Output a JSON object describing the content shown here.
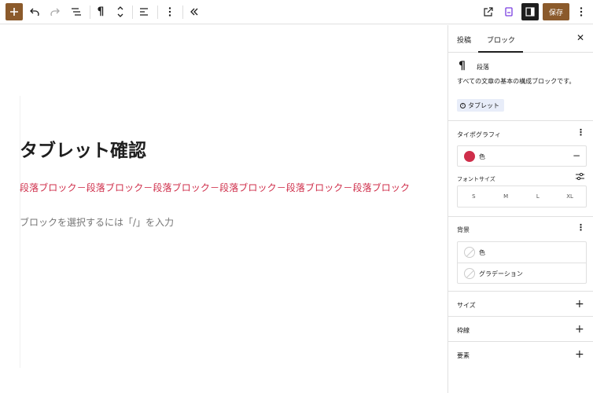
{
  "toolbar": {
    "inserter_icon": "plus-icon",
    "undo_icon": "undo-icon",
    "redo_icon": "redo-icon",
    "list_view_icon": "list-view-icon",
    "block_type_icon": "pilcrow-icon",
    "move_icon": "chevron-up-down-icon",
    "align_icon": "align-left-icon",
    "options_icon": "vertical-dots-icon",
    "collapse_icon": "double-chevron-left-icon",
    "view_icon": "external-link-icon",
    "bookmark_icon": "bookmark-icon",
    "settings_icon": "sidebar-icon",
    "save_label": "保存",
    "more_icon": "vertical-dots-icon"
  },
  "editor": {
    "title": "タブレット確認",
    "paragraph": "段落ブロック－段落ブロック－段落ブロック－段落ブロック－段落ブロック－段落ブロック",
    "placeholder": "ブロックを選択するには「/」を入力"
  },
  "sidebar": {
    "tabs": [
      "投稿",
      "ブロック"
    ],
    "active_tab": "ブロック",
    "close_icon": "close-icon",
    "block": {
      "icon": "pilcrow-icon",
      "name": "段落",
      "description": "すべての文章の基本の構成ブロックです。",
      "badge": "タブレット"
    },
    "typography": {
      "title": "タイポグラフィ",
      "color_label": "色",
      "font_size_label": "フォントサイズ",
      "font_sizes": [
        "S",
        "M",
        "L",
        "XL"
      ]
    },
    "background": {
      "title": "背景",
      "color_label": "色",
      "gradient_label": "グラデーション"
    },
    "size": {
      "title": "サイズ"
    },
    "border": {
      "title": "枠線"
    },
    "elements": {
      "title": "要素"
    }
  },
  "colors": {
    "accent_brown": "#8b5a2b",
    "paragraph_red": "#cf2e4a",
    "badge_bg": "#e8edf9"
  }
}
